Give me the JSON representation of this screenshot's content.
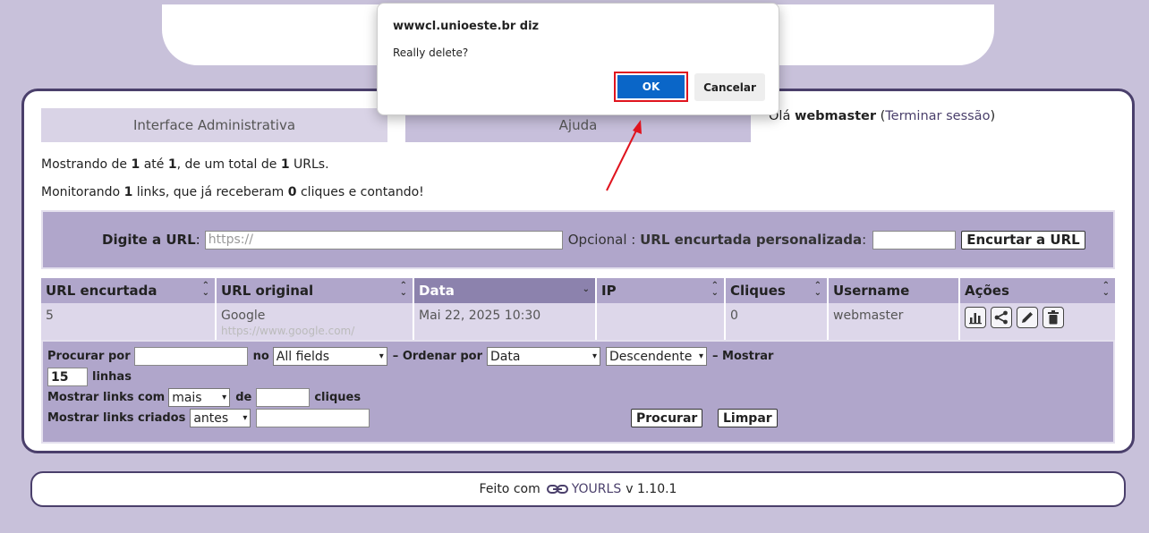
{
  "admin_tab": "Interface Administrativa",
  "help_tab": "Ajuda",
  "greeting": {
    "prefix": "Olá",
    "user": "webmaster",
    "open": "(",
    "logout": "Terminar sessão",
    "close": ")"
  },
  "info": {
    "line1": {
      "a": "Mostrando de",
      "from": "1",
      "b": "até",
      "to": "1",
      "c": ", de um total de",
      "total": "1",
      "d": "URLs."
    },
    "line2": {
      "a": "Monitorando",
      "links": "1",
      "b": "links, que já receberam",
      "clicks": "0",
      "c": "cliques e contando!"
    }
  },
  "add_form": {
    "url_label": "Digite a URL",
    "colon": ":",
    "url_placeholder": "https://",
    "optional": "Opcional",
    "custom_label": "URL encurtada personalizada",
    "submit": "Encurtar a URL"
  },
  "table": {
    "headers": [
      "URL encurtada",
      "URL original",
      "Data",
      "IP",
      "Cliques",
      "Username",
      "Ações"
    ],
    "row": {
      "short": "5",
      "title": "Google",
      "url": "https://www.google.com/",
      "date": "Mai 22, 2025 10:30",
      "ip": "",
      "clicks": "0",
      "username": "webmaster"
    },
    "action_icons": [
      "stats-icon",
      "share-icon",
      "edit-icon",
      "delete-icon"
    ]
  },
  "filters": {
    "search_label": "Procurar por",
    "in_label": "no",
    "field_select": "All fields",
    "sort_label": "– Ordenar por",
    "sort_select": "Data",
    "order_select": "Descendente",
    "show_label": "– Mostrar",
    "rows_value": "15",
    "rows_label": "linhas",
    "clicks_label": "Mostrar links com",
    "clicks_select": "mais",
    "of_label": "de",
    "clicks_suffix": "cliques",
    "created_label": "Mostrar links criados",
    "created_select": "antes",
    "search_button": "Procurar",
    "clear_button": "Limpar"
  },
  "footer": {
    "made_with": "Feito com",
    "brand": "YOURLS",
    "version": "v 1.10.1"
  },
  "dialog": {
    "title": "wwwcl.unioeste.br diz",
    "message": "Really delete?",
    "ok": "OK",
    "cancel": "Cancelar"
  },
  "colors": {
    "accent": "#0a66c8",
    "highlight": "#e0141e",
    "panel": "#b0a6cb",
    "border": "#4a3f6b"
  }
}
